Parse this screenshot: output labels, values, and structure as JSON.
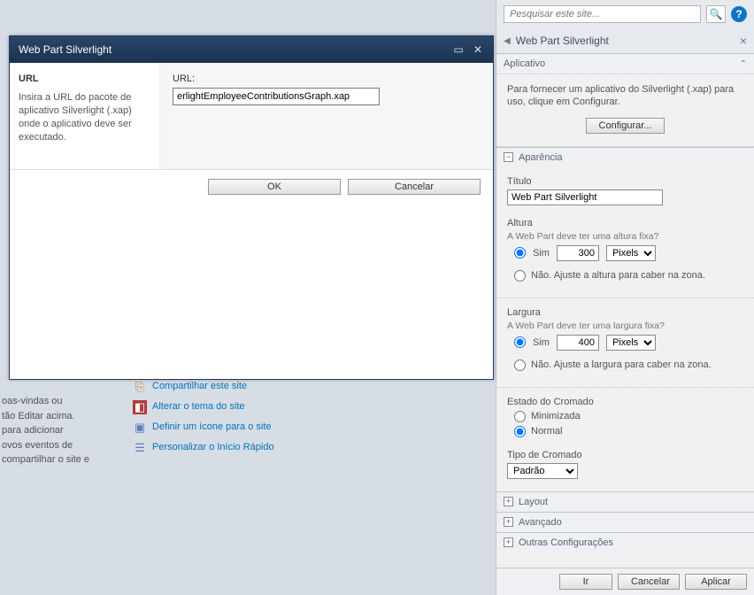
{
  "search": {
    "placeholder": "Pesquisar este site...",
    "help_icon": "help-icon"
  },
  "rightPanel": {
    "title": "Web Part Silverlight",
    "aplicativo": {
      "label": "Aplicativo",
      "desc": "Para fornecer um aplicativo do Silverlight (.xap) para uso, clique em Configurar.",
      "button": "Configurar..."
    },
    "aparencia": {
      "label": "Aparência",
      "titulo": {
        "label": "Título",
        "value": "Web Part Silverlight"
      },
      "altura": {
        "label": "Altura",
        "question": "A Web Part deve ter uma altura fixa?",
        "sim": "Sim",
        "value": "300",
        "unit": "Pixels",
        "nao": "Não. Ajuste a altura para caber na zona."
      },
      "largura": {
        "label": "Largura",
        "question": "A Web Part deve ter uma largura fixa?",
        "sim": "Sim",
        "value": "400",
        "unit": "Pixels",
        "nao": "Não. Ajuste a largura para caber na zona."
      },
      "cromado": {
        "label": "Estado do Cromado",
        "min": "Minimizada",
        "normal": "Normal"
      },
      "tipo": {
        "label": "Tipo de Cromado",
        "value": "Padrão"
      }
    },
    "sections": {
      "layout": "Layout",
      "avancado": "Avançado",
      "outras": "Outras Configurações"
    },
    "buttons": {
      "ir": "Ir",
      "cancelar": "Cancelar",
      "aplicar": "Aplicar"
    }
  },
  "bgText": {
    "l1": "oas-vindas ou",
    "l2": "tão Editar acima.",
    "l3": " para adicionar",
    "l4": "ovos eventos de",
    "l5": "compartilhar o site e"
  },
  "bgLinks": {
    "share": "Compartilhar este site",
    "theme": "Alterar o tema do site",
    "define": "Definir um ícone para o site",
    "personalize": "Personalizar o Início Rápido"
  },
  "modal": {
    "title": "Web Part Silverlight",
    "left": {
      "heading": "URL",
      "desc": "Insira a URL do pacote de aplicativo Silverlight (.xap) onde o aplicativo deve ser executado."
    },
    "right": {
      "label": "URL:",
      "value": "erlightEmployeeContributionsGraph.xap"
    },
    "buttons": {
      "ok": "OK",
      "cancel": "Cancelar"
    }
  }
}
